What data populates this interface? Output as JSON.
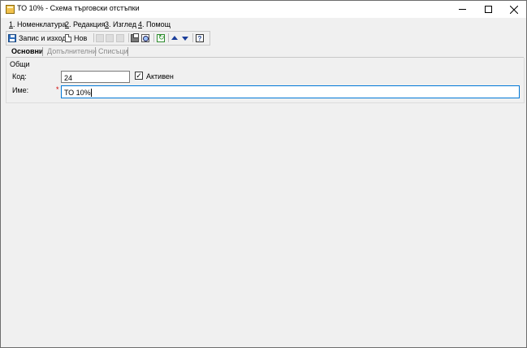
{
  "window": {
    "title": "ТО 10% - Схема търговски отстъпки"
  },
  "menu": {
    "items": [
      {
        "num": "1",
        "label": ". Номенклатура"
      },
      {
        "num": "2",
        "label": ". Редакция"
      },
      {
        "num": "3",
        "label": ". Изглед"
      },
      {
        "num": "4",
        "label": ". Помощ"
      }
    ]
  },
  "toolbar": {
    "save_label": "Запис и изход",
    "new_label": "Нов",
    "help_glyph": "?"
  },
  "tabs": [
    {
      "label": "Основни",
      "active": true
    },
    {
      "label": "Допълнителни",
      "active": false
    },
    {
      "label": "Списъци",
      "active": false
    }
  ],
  "form": {
    "group_label": "Общи",
    "code_label": "Код:",
    "code_value": "24",
    "active_label": "Активен",
    "active_checked": true,
    "active_check_glyph": "✓",
    "name_label": "Име:",
    "name_required_mark": "*",
    "name_value": "ТО 10%"
  },
  "colors": {
    "focus_border": "#0078d7",
    "required": "#d00000"
  }
}
